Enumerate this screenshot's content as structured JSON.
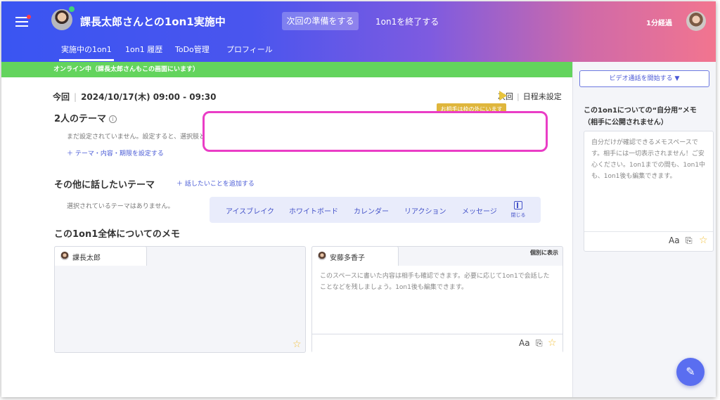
{
  "header": {
    "title": "課長太郎さんとの1on1実施中",
    "prepare_button": "次回の準備をする",
    "end_button": "1on1を終了する",
    "elapsed": "1分経過"
  },
  "tabs": [
    {
      "label": "実施中の1on1",
      "active": true
    },
    {
      "label": "1on1 履歴",
      "active": false
    },
    {
      "label": "ToDo管理",
      "active": false
    },
    {
      "label": "プロフィール",
      "active": false
    }
  ],
  "online_banner": "オンライン中（課長太郎さんもこの画面にいます）",
  "session": {
    "label": "今回",
    "datetime": "2024/10/17(木) 09:00 - 09:30",
    "next_label": "次回",
    "schedule_status": "日程未設定",
    "tooltip": "お相手は枠の外にいます"
  },
  "theme": {
    "heading": "2人のテーマ",
    "empty_text": "まだ設定されていません。設定すると、選択肢として表示されます。",
    "add_link": "テーマ・内容・期限を設定する"
  },
  "other_topics": {
    "heading": "その他に話したいテーマ",
    "add_link": "話したいことを追加する",
    "empty_text": "選択されているテーマはありません。"
  },
  "toolbar": {
    "items": [
      "アイスブレイク",
      "ホワイトボード",
      "カレンダー",
      "リアクション",
      "メッセージ"
    ],
    "close_label": "閉じる"
  },
  "memo": {
    "heading": "この1on1全体についてのメモ",
    "left_user": "課長太郎",
    "right_user": "安藤多香子",
    "show_separately": "個別に表示",
    "right_placeholder": "このスペースに書いた内容は相手も確認できます。必要に応じて1on1で会話したことなどを残しましょう。1on1後も編集できます。",
    "format_label": "Aa"
  },
  "sidebar": {
    "video_button": "ビデオ通話を開始する ▼",
    "private_memo_title": "この1on1についての“自分用”メモ（相手に公開されません）",
    "private_memo_placeholder": "自分だけが確認できるメモスペースです。相手には一切表示されません！ご安心ください。1on1までの間も、1on1中も、1on1後も編集できます。",
    "format_label": "Aa"
  },
  "colors": {
    "header_start": "#3a55f2",
    "header_end": "#f2758f",
    "online_green": "#63d45d",
    "highlight_magenta": "#ea3dc6",
    "accent_blue": "#4a58d6",
    "tooltip_gold": "#dfb63c"
  }
}
